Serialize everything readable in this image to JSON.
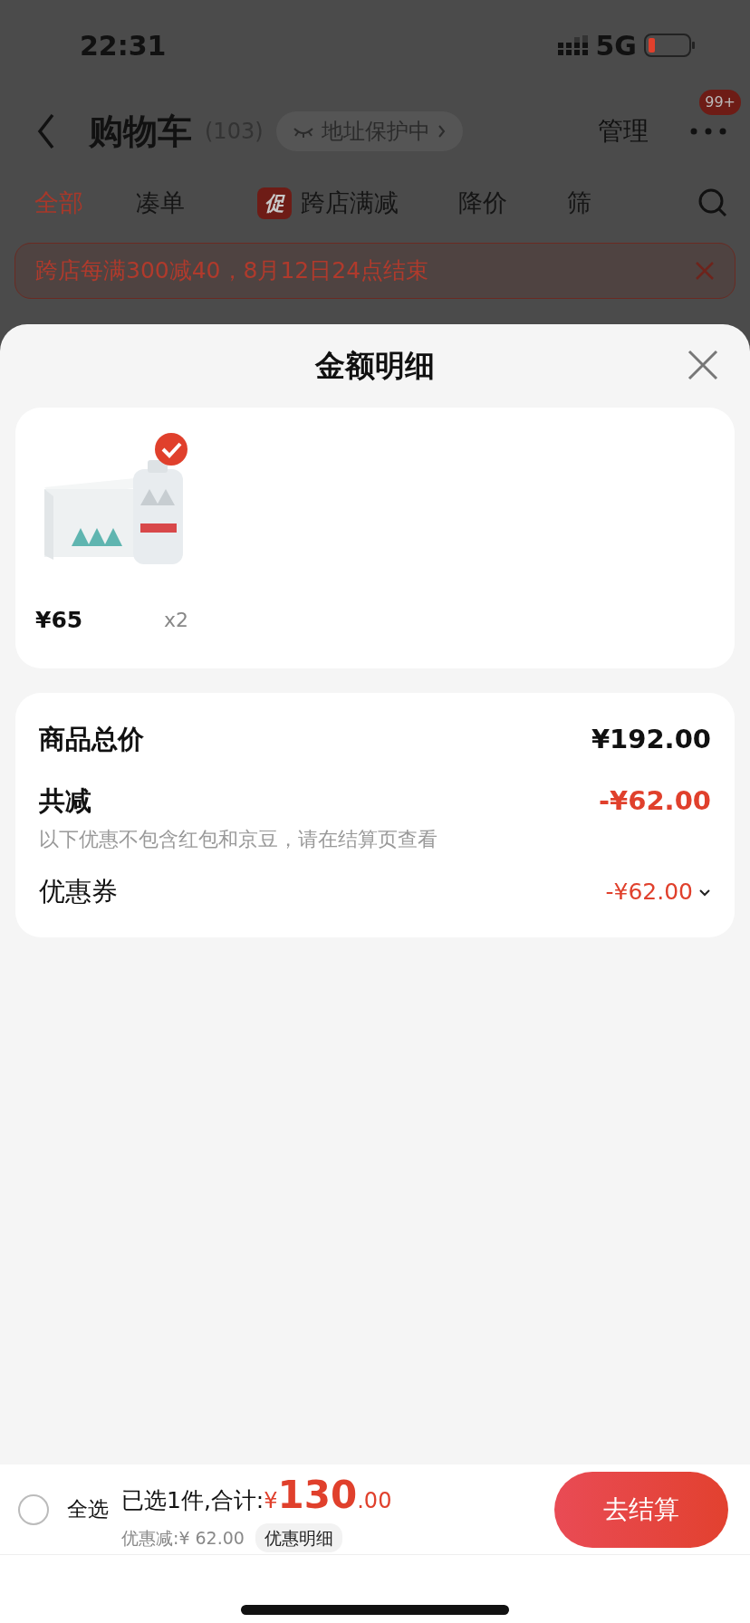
{
  "status_bar": {
    "time": "22:31",
    "network": "5G"
  },
  "header": {
    "title": "购物车",
    "count": "(103)",
    "address_badge": "地址保护中",
    "manage": "管理",
    "more_badge": "99+"
  },
  "tabs": [
    {
      "label": "全部",
      "selected": true
    },
    {
      "label": "凑单",
      "selected": false
    },
    {
      "label": "跨店满减",
      "selected": false,
      "tag": "促"
    },
    {
      "label": "降价",
      "selected": false
    },
    {
      "label": "筛",
      "selected": false
    }
  ],
  "promo_banner": {
    "text": "跨店每满300减40，8月12日24点结束"
  },
  "sheet": {
    "title": "金额明细",
    "items": [
      {
        "kind": "picture",
        "price": "¥65",
        "quantity": "x2",
        "checked": true
      }
    ],
    "summary": [
      {
        "kind": "total",
        "label": "商品总价",
        "value": "¥192.00"
      },
      {
        "kind": "discount",
        "label": "共减",
        "value": "-¥62.00",
        "note": "以下优惠不包含红包和京豆，请在结算页查看"
      },
      {
        "kind": "coupon",
        "label": "优惠券",
        "value": "-¥62.00",
        "expanded": false
      }
    ]
  },
  "bottom_bar": {
    "select_all": {
      "label": "全选",
      "checked": false
    },
    "selected_text": "已选1件,合计:",
    "currency": "¥",
    "total_integer": "130",
    "total_decimal": ".00",
    "discount_text": "优惠减:¥ 62.00",
    "details_button": "优惠明细",
    "checkout_button": "去结算"
  }
}
